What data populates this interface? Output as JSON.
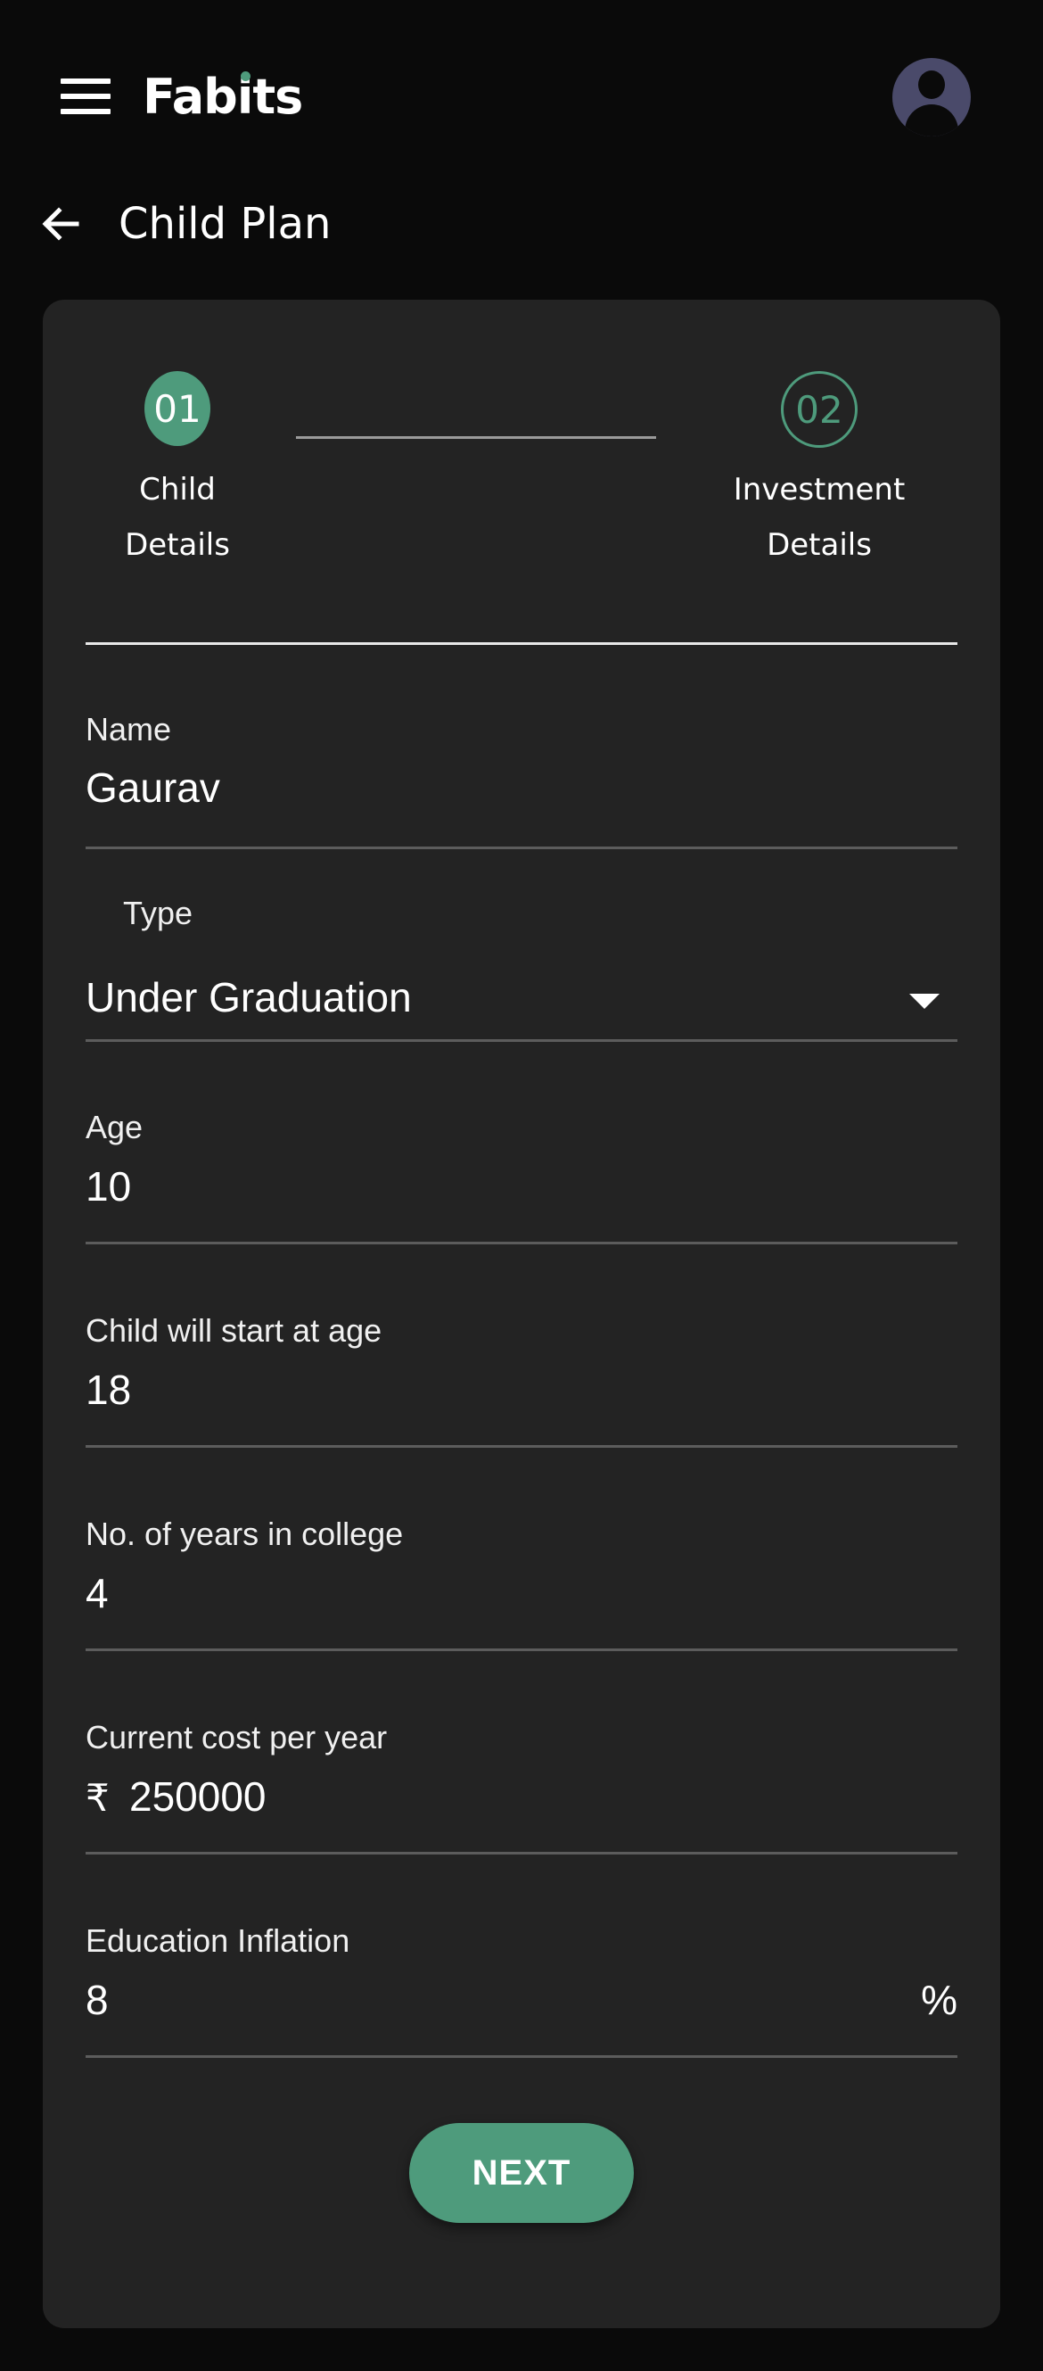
{
  "header": {
    "logo_text": "Fabits"
  },
  "page": {
    "title": "Child Plan"
  },
  "stepper": {
    "steps": [
      {
        "number": "01",
        "label_line1": "Child",
        "label_line2": "Details"
      },
      {
        "number": "02",
        "label_line1": "Investment",
        "label_line2": "Details"
      }
    ]
  },
  "form": {
    "name": {
      "label": "Name",
      "value": "Gaurav"
    },
    "type": {
      "label": "Type",
      "value": "Under Graduation"
    },
    "age": {
      "label": "Age",
      "value": "10"
    },
    "start_age": {
      "label": "Child will start at age",
      "value": "18"
    },
    "years_in_college": {
      "label": "No. of years in college",
      "value": "4"
    },
    "current_cost": {
      "label": "Current cost per year",
      "prefix": "₹",
      "value": "250000"
    },
    "inflation": {
      "label": "Education Inflation",
      "value": "8",
      "suffix": "%"
    }
  },
  "actions": {
    "next_label": "NEXT"
  },
  "colors": {
    "accent": "#4e9b7c",
    "background": "#0a0a0a",
    "card": "#232323",
    "avatar": "#4a4a6a"
  },
  "icons": {
    "menu": "hamburger-menu-icon",
    "avatar": "user-avatar-icon",
    "back": "arrow-left-icon",
    "dropdown": "caret-down-icon"
  }
}
